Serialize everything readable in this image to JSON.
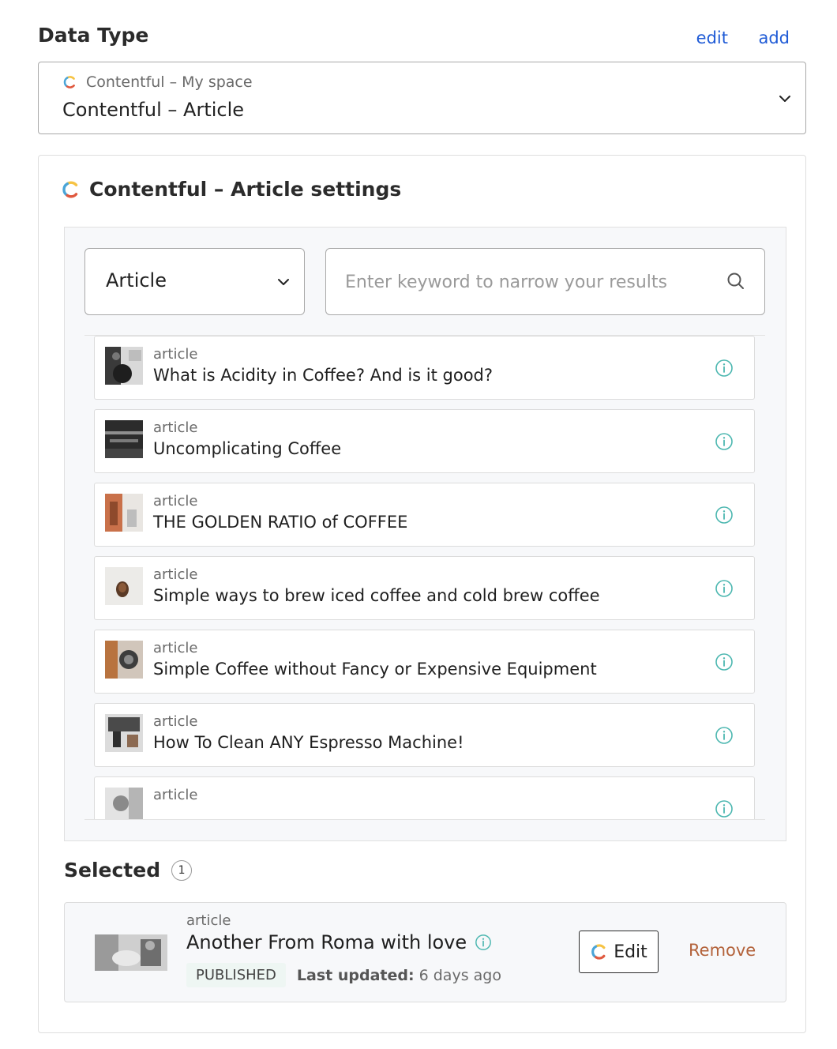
{
  "header": {
    "title": "Data Type",
    "edit_label": "edit",
    "add_label": "add"
  },
  "data_type_select": {
    "source_label": "Contentful – My space",
    "value": "Contentful – Article"
  },
  "settings": {
    "title": "Contentful – Article settings",
    "content_type_select": {
      "value": "Article"
    },
    "search": {
      "placeholder": "Enter keyword to narrow your results"
    },
    "items": [
      {
        "type": "article",
        "title": "What is Acidity in Coffee? And is it good?"
      },
      {
        "type": "article",
        "title": "Uncomplicating Coffee"
      },
      {
        "type": "article",
        "title": "THE GOLDEN RATIO of COFFEE"
      },
      {
        "type": "article",
        "title": "Simple ways to brew iced coffee and cold brew coffee"
      },
      {
        "type": "article",
        "title": "Simple Coffee without Fancy or Expensive Equipment"
      },
      {
        "type": "article",
        "title": "How To Clean ANY Espresso Machine!"
      },
      {
        "type": "article",
        "title": ""
      }
    ]
  },
  "selected": {
    "label": "Selected",
    "count": "1",
    "item": {
      "type": "article",
      "title": "Another From Roma with love",
      "status": "PUBLISHED",
      "updated_key": "Last updated:",
      "updated_value": " 6 days ago"
    },
    "edit_label": "Edit",
    "remove_label": "Remove"
  },
  "colors": {
    "link": "#1f5bd6",
    "remove": "#b3623a",
    "info": "#4cb7b0",
    "status_bg": "#eef6f3"
  },
  "icons": [
    "contentful-logo-icon",
    "chevron-down-icon",
    "search-icon",
    "info-icon"
  ]
}
